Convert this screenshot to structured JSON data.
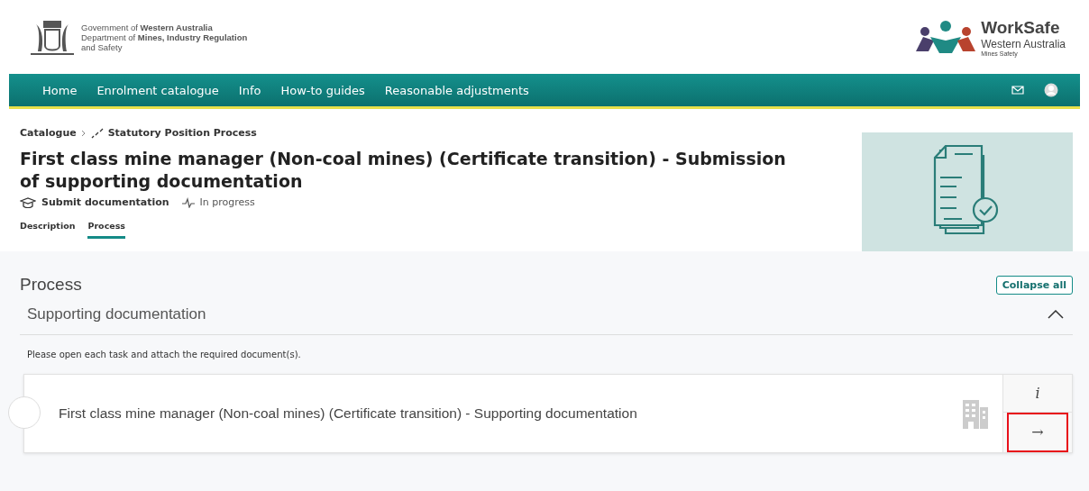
{
  "header": {
    "gov_lines": [
      "Government of **Western Australia**",
      "Department of **Mines, Industry Regulation**",
      "and Safety"
    ],
    "brand": {
      "name": "WorkSafe",
      "region": "Western Australia",
      "division": "Mines Safety"
    }
  },
  "nav": {
    "items": [
      {
        "label": "Home"
      },
      {
        "label": "Enrolment catalogue"
      },
      {
        "label": "Info"
      },
      {
        "label": "How-to guides"
      },
      {
        "label": "Reasonable adjustments"
      }
    ]
  },
  "breadcrumb": [
    {
      "label": "Catalogue",
      "kind": "link"
    },
    {
      "label": "Statutory Position Process",
      "kind": "current"
    }
  ],
  "title": "First class mine manager (Non-coal mines) (Certificate transition) - Submission of supporting documentation",
  "meta": {
    "type": "Submit documentation",
    "status": "In progress"
  },
  "tabs": [
    {
      "label": "Description",
      "selected": false
    },
    {
      "label": "Process",
      "selected": true
    }
  ],
  "process": {
    "heading": "Process",
    "collapse_button": "Collapse all",
    "section": {
      "title": "Supporting documentation",
      "expanded": true,
      "instruction": "Please open each task and attach the required document(s).",
      "tasks": [
        {
          "title": "First class mine manager (Non-coal mines) (Certificate transition) - Supporting documentation",
          "info": "i",
          "open": "→",
          "highlighted": true
        }
      ]
    }
  }
}
